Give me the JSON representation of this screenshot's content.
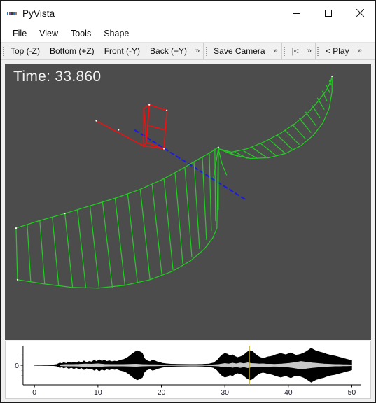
{
  "window": {
    "title": "PyVista",
    "icon": "pyvista-logo-icon",
    "controls": {
      "minimize": "minimize-icon",
      "maximize": "maximize-icon",
      "close": "close-icon"
    }
  },
  "menubar": {
    "items": [
      {
        "label": "File"
      },
      {
        "label": "View"
      },
      {
        "label": "Tools"
      },
      {
        "label": "Shape"
      }
    ]
  },
  "toolbar": {
    "groups": [
      {
        "name": "camera-views",
        "buttons": [
          {
            "label": "Top (-Z)"
          },
          {
            "label": "Bottom (+Z)"
          },
          {
            "label": "Front (-Y)"
          },
          {
            "label": "Back (+Y)"
          }
        ],
        "overflow": "»"
      },
      {
        "name": "camera-save",
        "buttons": [
          {
            "label": "Save Camera"
          }
        ],
        "overflow": "»"
      },
      {
        "name": "transport-first",
        "buttons": [
          {
            "label": "|<"
          }
        ],
        "overflow": "»"
      },
      {
        "name": "transport-play",
        "buttons": [
          {
            "label": "< Play"
          }
        ],
        "overflow": "»"
      }
    ]
  },
  "viewport": {
    "background_color": "#4c4c4c",
    "time_label": "Time: 33.860",
    "actors": {
      "mesh_color": "#22cc22",
      "frame_color": "#ee1111",
      "axis_color": "#1c1ce0",
      "point_color": "#ffffff"
    }
  },
  "chart_data": {
    "type": "line",
    "title": "",
    "xlabel": "",
    "ylabel": "",
    "xlim": [
      -1.8,
      51.5
    ],
    "ylim": [
      -1.15,
      1.15
    ],
    "xticks": [
      0,
      10,
      20,
      30,
      40,
      50
    ],
    "xticklabels": [
      "0",
      "10",
      "20",
      "30",
      "40",
      "50"
    ],
    "yticks": [
      0
    ],
    "yticklabels": [
      "0"
    ],
    "yminorticks": [
      -0.6,
      -0.3,
      0.3,
      0.6
    ],
    "grid": false,
    "legend": null,
    "series": [
      {
        "name": "signal-envelope-outer",
        "color": "#000000",
        "x": [
          0,
          0.5,
          1,
          1.5,
          2,
          2.5,
          3,
          3.5,
          4,
          4.3,
          4.6,
          5,
          5.4,
          5.8,
          6.2,
          6.6,
          7,
          7.4,
          7.8,
          8.2,
          8.6,
          9,
          9.4,
          9.8,
          10.2,
          10.6,
          11,
          11.4,
          11.8,
          12.2,
          12.6,
          13,
          13.5,
          14,
          14.5,
          15,
          15.4,
          15.8,
          16.2,
          16.6,
          17,
          17.3,
          17.6,
          17.9,
          18.2,
          18.6,
          19,
          19.4,
          19.8,
          20.2,
          20.8,
          21.5,
          22.5,
          23.5,
          24.5,
          25.5,
          26.5,
          27.5,
          28.2,
          28.8,
          29.2,
          29.6,
          30,
          30.4,
          30.8,
          31.2,
          31.6,
          32,
          32.4,
          32.8,
          33.2,
          33.6,
          34,
          34.4,
          34.8,
          35.2,
          35.6,
          36,
          36.4,
          36.8,
          37.2,
          37.6,
          38,
          38.4,
          38.8,
          39.2,
          39.6,
          40,
          40.4,
          40.8,
          41.2,
          41.6,
          42,
          42.4,
          42.8,
          43.2,
          43.6,
          44,
          44.4,
          44.8,
          45.2,
          45.6,
          46,
          46.4,
          46.8,
          47.2,
          47.6,
          48,
          48.4,
          48.8,
          49.2,
          49.6,
          50
        ],
        "amplitude": [
          0.01,
          0.012,
          0.015,
          0.018,
          0.02,
          0.025,
          0.03,
          0.05,
          0.14,
          0.1,
          0.16,
          0.11,
          0.19,
          0.13,
          0.2,
          0.14,
          0.22,
          0.15,
          0.26,
          0.17,
          0.23,
          0.2,
          0.3,
          0.22,
          0.34,
          0.24,
          0.3,
          0.23,
          0.27,
          0.22,
          0.25,
          0.23,
          0.3,
          0.34,
          0.42,
          0.55,
          0.68,
          0.78,
          0.86,
          0.8,
          0.72,
          0.42,
          0.3,
          0.25,
          0.22,
          0.3,
          0.26,
          0.2,
          0.16,
          0.12,
          0.09,
          0.07,
          0.06,
          0.055,
          0.05,
          0.05,
          0.06,
          0.08,
          0.14,
          0.3,
          0.48,
          0.62,
          0.7,
          0.66,
          0.56,
          0.62,
          0.52,
          0.46,
          0.5,
          0.56,
          0.68,
          0.8,
          0.86,
          0.8,
          0.66,
          0.54,
          0.46,
          0.42,
          0.45,
          0.5,
          0.52,
          0.56,
          0.62,
          0.66,
          0.7,
          0.66,
          0.62,
          0.68,
          0.74,
          0.66,
          0.6,
          0.62,
          0.66,
          0.72,
          0.8,
          0.9,
          1.0,
          0.92,
          0.84,
          0.8,
          0.76,
          0.72,
          0.66,
          0.62,
          0.58,
          0.56,
          0.52,
          0.48,
          0.44,
          0.4,
          0.36,
          0.32,
          0.28
        ]
      },
      {
        "name": "signal-envelope-inner",
        "color": "#c8c8c8",
        "x": [
          4,
          5,
          6,
          7,
          8,
          9,
          10,
          11,
          12,
          13,
          14,
          15,
          16,
          17,
          18,
          19,
          20,
          21,
          22,
          23,
          24,
          25,
          26,
          27,
          28,
          29,
          30,
          30.6,
          31.2,
          31.8,
          32.4,
          33,
          33.6,
          34.2,
          34.8,
          35.4,
          36,
          36.6,
          37.2,
          37.8,
          38.4,
          39,
          39.6,
          40.2,
          40.8,
          41.4,
          42,
          42.6,
          43.2,
          43.8,
          44.4,
          45,
          45.6,
          46.2,
          46.8,
          47.4,
          48,
          48.6,
          49.2,
          50
        ],
        "amplitude": [
          0.03,
          0.05,
          0.05,
          0.06,
          0.08,
          0.07,
          0.09,
          0.06,
          0.05,
          0.05,
          0.05,
          0.06,
          0.07,
          0.05,
          0.04,
          0.04,
          0.03,
          0.02,
          0.02,
          0.02,
          0.02,
          0.02,
          0.02,
          0.02,
          0.03,
          0.05,
          0.11,
          0.08,
          0.13,
          0.09,
          0.14,
          0.1,
          0.15,
          0.11,
          0.1,
          0.08,
          0.09,
          0.07,
          0.07,
          0.06,
          0.07,
          0.08,
          0.1,
          0.12,
          0.15,
          0.19,
          0.23,
          0.2,
          0.17,
          0.14,
          0.12,
          0.1,
          0.08,
          0.07,
          0.06,
          0.05,
          0.05,
          0.04,
          0.04,
          0.03
        ]
      }
    ],
    "cursor": {
      "name": "time-cursor",
      "x": 33.86,
      "color": "#b8a520"
    }
  }
}
